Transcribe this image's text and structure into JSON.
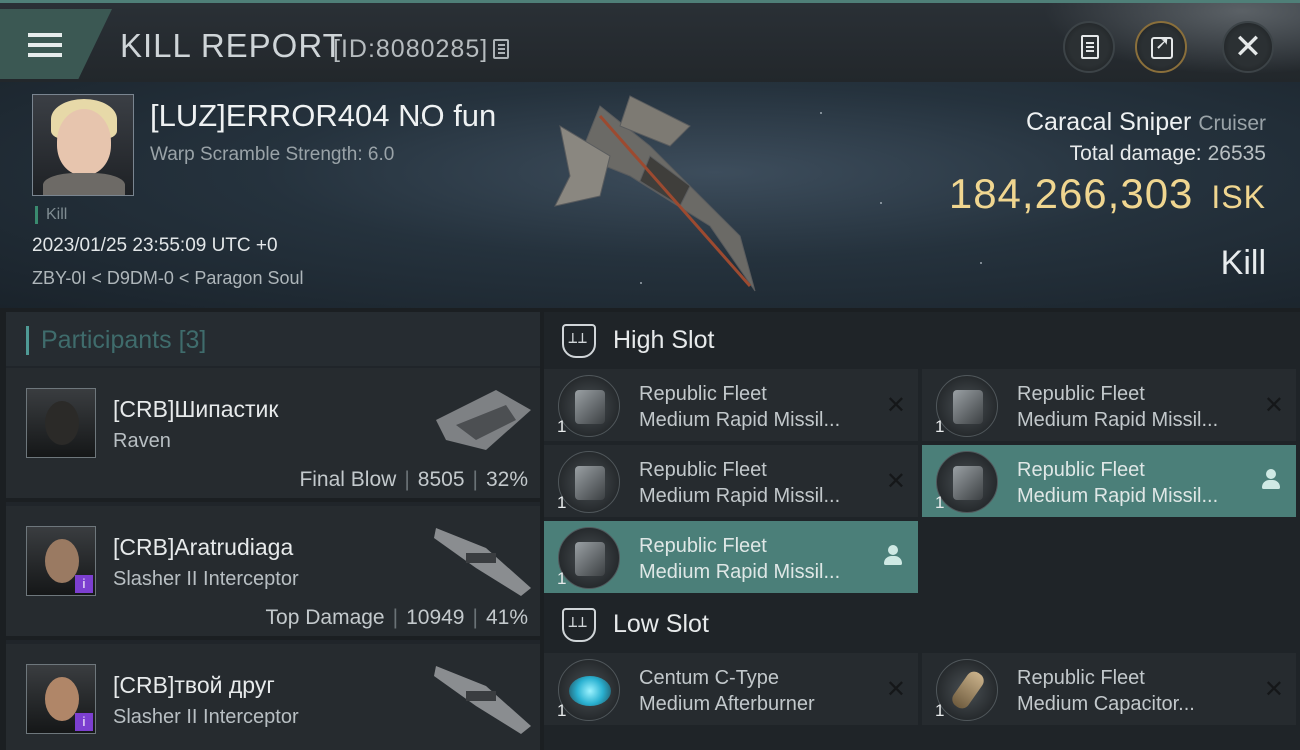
{
  "header": {
    "title": "KILL REPORT",
    "report_id": "[ID:8080285]"
  },
  "victim": {
    "name": "[LUZ]ERROR404 NO fun",
    "warp_scramble": "Warp Scramble Strength: 6.0",
    "tag": "Kill",
    "datetime": "2023/01/25 23:55:09 UTC +0",
    "location": "ZBY-0I < D9DM-0 < Paragon Soul",
    "ship_name": "Caracal Sniper",
    "ship_class": "Cruiser",
    "total_damage_label": "Total damage:",
    "total_damage": "26535",
    "isk_value": "184,266,303",
    "isk_unit": "ISK",
    "result": "Kill"
  },
  "participants": {
    "title": "Participants",
    "count": "[3]",
    "items": [
      {
        "name": "[CRB]Шипастик",
        "ship": "Raven",
        "stat_label": "Final Blow",
        "damage": "8505",
        "percent": "32%"
      },
      {
        "name": "[CRB]Aratrudiaga",
        "ship": "Slasher II Interceptor",
        "stat_label": "Top Damage",
        "damage": "10949",
        "percent": "41%"
      },
      {
        "name": "[CRB]твой друг",
        "ship": "Slasher II Interceptor"
      }
    ]
  },
  "fitting": {
    "high_slot_title": "High Slot",
    "low_slot_title": "Low Slot",
    "high": [
      {
        "line1": "Republic Fleet",
        "line2": "Medium Rapid Missil...",
        "qty": "1",
        "state": "destroyed"
      },
      {
        "line1": "Republic Fleet",
        "line2": "Medium Rapid Missil...",
        "qty": "1",
        "state": "destroyed"
      },
      {
        "line1": "Republic Fleet",
        "line2": "Medium Rapid Missil...",
        "qty": "1",
        "state": "destroyed"
      },
      {
        "line1": "Republic Fleet",
        "line2": "Medium Rapid Missil...",
        "qty": "1",
        "state": "dropped"
      },
      {
        "line1": "Republic Fleet",
        "line2": "Medium Rapid Missil...",
        "qty": "1",
        "state": "dropped"
      }
    ],
    "low": [
      {
        "line1": "Centum C-Type",
        "line2": "Medium Afterburner",
        "qty": "1",
        "state": "destroyed"
      },
      {
        "line1": "Republic Fleet",
        "line2": "Medium Capacitor...",
        "qty": "1",
        "state": "destroyed"
      }
    ]
  },
  "colors": {
    "accent": "#4b7f79",
    "isk": "#f0d690",
    "background": "#1b1f22"
  }
}
